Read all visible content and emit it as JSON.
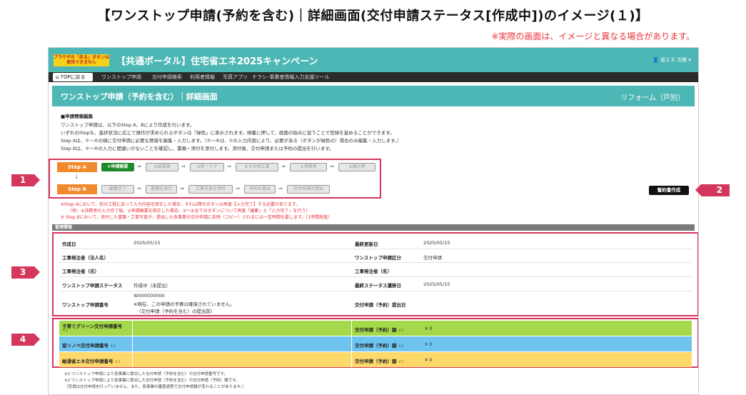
{
  "doc": {
    "title": "【ワンストップ申請(予約を含む)｜詳細画面(交付申請ステータス[作成中])のイメージ(１)】",
    "note": "※実際の画面は、イメージと異なる場合があります。"
  },
  "header": {
    "notice": "ブラウザの「戻る」ボタンは使用できません",
    "title": "【共通ポータル】住宅省エネ2025キャンペーン",
    "user": "👤 省エネ 次郎 ▾"
  },
  "nav": {
    "home": "TOPに戻る",
    "items": [
      "ワンストップ申請",
      "交付申請検索",
      "利用者情報",
      "写真アプリ",
      "チラシ･事業者情報入力支援ツール"
    ]
  },
  "page": {
    "title": "ワンストップ申請（予約を含む）｜詳細画面",
    "category": "リフォーム（戸別）"
  },
  "info": {
    "title": "■申請情報編集",
    "lines": [
      "ワンストップ申請は、以下のStep A、Bにより作成を行います。",
      "いずれのStepも、進捗状況に応じて操作が求められるボタンは「緑色」に表示されます。順番に押して、画面の指示に従うことで登録を進めることができます。",
      "Step Aは、①～⑥の順に交付申請に必要な情報を編集・入力します。（②～⑥は、①の入力内容により、必要がある（ボタンが緑色の）場合のみ編集・入力します。）",
      "Step Bは、①～⑥の入力に間違いがないことを確認し、書類・添付を添付します。添付後、交付申請または予約の提出を行います。"
    ]
  },
  "steps": {
    "a": {
      "label": "Step A",
      "buttons": [
        "①申請概要",
        "②結露器",
        "③窓・ドア",
        "④その他工事",
        "⑤消費者",
        "⑥振込等"
      ]
    },
    "b": {
      "label": "Step B",
      "buttons": [
        "編集完了",
        "書類を添付",
        "工事写真を添付",
        "予約の提出",
        "交付申請の提出"
      ]
    },
    "down": "↓",
    "arrow": "⇒"
  },
  "create_button": "誓約書作成",
  "notes_red": [
    "※Step Aにおいて、前の工程に戻って入力内容を修正した場合、それ以降のボタンは再度【入力完了】する必要があります。",
    "（例：⑤消費者の入力完了後、①申請概要を修正した場合、②～⑥全てのボタンについて再度「編集」と「入力完了」を行う）",
    "※ Step Bにおいて、添付した書類・工事写真が、提出した各事業の交付申請に反映（コピー）されるには一定時間を要します。（1時間程度）"
  ],
  "mgmt": {
    "section": "管理情報",
    "rows": [
      {
        "l1": "作成日",
        "v1": "2025/05/15",
        "l2": "最終更新日",
        "v2": "2025/05/15"
      },
      {
        "l1": "工事発注者（法人名）",
        "v1": "",
        "l2": "ワンストップ申請区分",
        "v2": "交付申請"
      },
      {
        "l1": "工事発注者（氏）",
        "v1": "",
        "l2": "工事発注者（名）",
        "v2": ""
      },
      {
        "l1": "ワンストップ申請ステータス",
        "v1": "作成中（未提出）",
        "l2": "最終ステータス遷移日",
        "v2": "2025/05/15"
      },
      {
        "l1": "ワンストップ申請番号",
        "v1": "W000000000",
        "v1b": "※現在、この申請の予算は確保されていません。",
        "v1c": "（交付申請（予約を含む）の提出前）",
        "l2": "交付申請（予約）提出日",
        "v2": ""
      }
    ]
  },
  "grants": [
    {
      "label": "子育てグリーン交付申請番号",
      "note": "※1",
      "amount_label": "交付申請（予約）額",
      "amount_note": "※2",
      "amount": "¥ 0",
      "color": "#a3d94a"
    },
    {
      "label": "窓リノベ交付申請番号",
      "note": "※1",
      "amount_label": "交付申請（予約）額",
      "amount_note": "※2",
      "amount": "¥ 0",
      "color": "#6fc3ef"
    },
    {
      "label": "給湯省エネ交付申請番号",
      "note": "※1",
      "amount_label": "交付申請（予約）額",
      "amount_note": "※2",
      "amount": "¥ 0",
      "color": "#fdd86a"
    }
  ],
  "footnotes": [
    "※1 ワンストップ申請により各事業に提出した交付申請（予約を含む）の交付申請番号です。",
    "※2 ワンストップ申請により各事業に提出した交付申請（予約を含む）の交付申請（予約）額です。",
    "（受領は交付申請を行っていません。また、各事業の審査過程で交付申請額が変わることがあります。）"
  ],
  "callouts": [
    "1",
    "2",
    "3",
    "4"
  ]
}
